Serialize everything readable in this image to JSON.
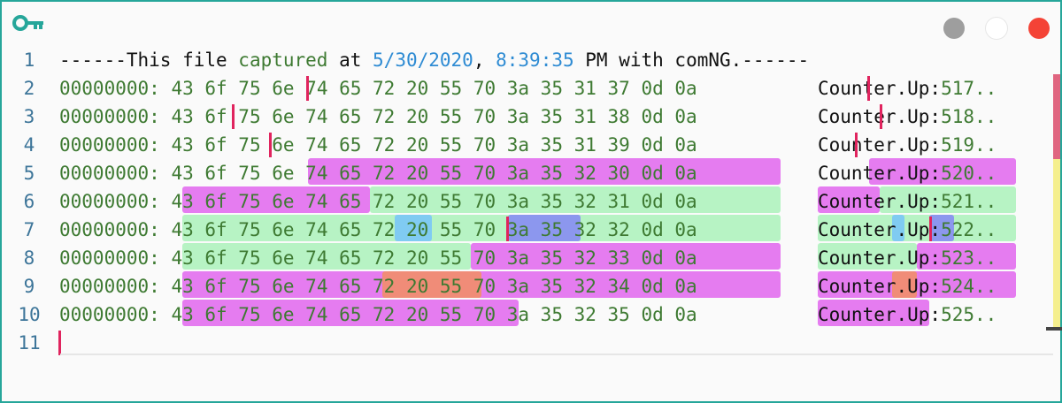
{
  "window": {
    "title_icon": "key-icon",
    "controls": [
      "minimize",
      "maximize",
      "close"
    ]
  },
  "line_numbers": [
    "1",
    "2",
    "3",
    "4",
    "5",
    "6",
    "7",
    "8",
    "9",
    "10",
    "11"
  ],
  "header": {
    "a": "------This file ",
    "b": "captured",
    "c": " at ",
    "date": "5/30/2020",
    "comma": ", ",
    "time": "8:39:35",
    "d": " PM with comNG.------"
  },
  "rows": [
    {
      "offset": "00000000:",
      "hex": "43 6f 75 6e 74 65 72 20 55 70 3a 35 31 37 0d 0a",
      "text": "Counter.Up:",
      "num": "517.."
    },
    {
      "offset": "00000000:",
      "hex": "43 6f 75 6e 74 65 72 20 55 70 3a 35 31 38 0d 0a",
      "text": "Counter.Up:",
      "num": "518.."
    },
    {
      "offset": "00000000:",
      "hex": "43 6f 75 6e 74 65 72 20 55 70 3a 35 31 39 0d 0a",
      "text": "Counter.Up:",
      "num": "519.."
    },
    {
      "offset": "00000000:",
      "hex": "43 6f 75 6e 74 65 72 20 55 70 3a 35 32 30 0d 0a",
      "text": "Counter.Up:",
      "num": "520.."
    },
    {
      "offset": "00000000:",
      "hex": "43 6f 75 6e 74 65 72 20 55 70 3a 35 32 31 0d 0a",
      "text": "Counter.Up:",
      "num": "521.."
    },
    {
      "offset": "00000000:",
      "hex": "43 6f 75 6e 74 65 72 20 55 70 3a 35 32 32 0d 0a",
      "text": "Counter.Up:",
      "num": "522.."
    },
    {
      "offset": "00000000:",
      "hex": "43 6f 75 6e 74 65 72 20 55 70 3a 35 32 33 0d 0a",
      "text": "Counter.Up:",
      "num": "523.."
    },
    {
      "offset": "00000000:",
      "hex": "43 6f 75 6e 74 65 72 20 55 70 3a 35 32 34 0d 0a",
      "text": "Counter.Up:",
      "num": "524.."
    },
    {
      "offset": "00000000:",
      "hex": "43 6f 75 6e 74 65 72 20 55 70 3a 35 32 35 0d 0a",
      "text": "Counter.Up:",
      "num": "525.."
    }
  ],
  "colors": {
    "frame": "#26a69a",
    "line_number": "#3d7599",
    "hex_text": "#3e7a32",
    "date_time": "#2e8bd3",
    "cursor": "#e0245e",
    "highlight_pink": "#e57cf0",
    "highlight_green": "#b7f3c4",
    "highlight_blue": "#80cbf2",
    "highlight_purple": "#8c97ee",
    "highlight_orange": "#f08c78"
  }
}
